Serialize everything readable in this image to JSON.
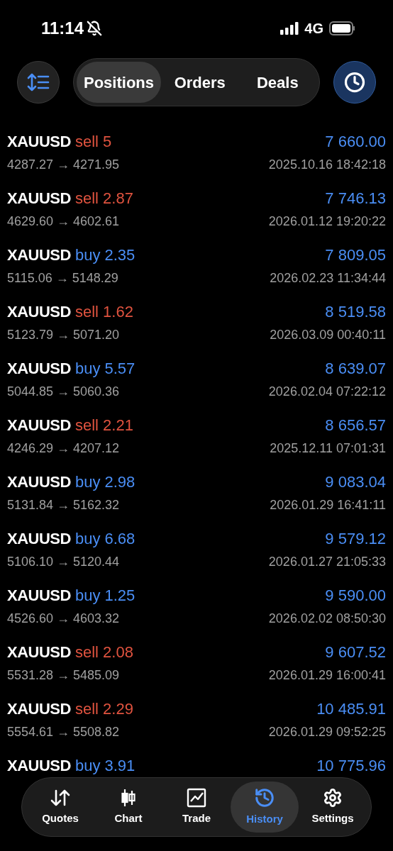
{
  "status_bar": {
    "time": "11:14",
    "network": "4G"
  },
  "segments": [
    {
      "label": "Positions",
      "selected": true
    },
    {
      "label": "Orders",
      "selected": false
    },
    {
      "label": "Deals",
      "selected": false
    }
  ],
  "deals": [
    {
      "symbol": "XAUUSD",
      "side": "sell",
      "volume": "5",
      "prices": "4287.27 → 4271.95",
      "profit": "7 660.00",
      "time": "2025.10.16 18:42:18"
    },
    {
      "symbol": "XAUUSD",
      "side": "sell",
      "volume": "2.87",
      "prices": "4629.60 → 4602.61",
      "profit": "7 746.13",
      "time": "2026.01.12 19:20:22"
    },
    {
      "symbol": "XAUUSD",
      "side": "buy",
      "volume": "2.35",
      "prices": "5115.06 → 5148.29",
      "profit": "7 809.05",
      "time": "2026.02.23 11:34:44"
    },
    {
      "symbol": "XAUUSD",
      "side": "sell",
      "volume": "1.62",
      "prices": "5123.79 → 5071.20",
      "profit": "8 519.58",
      "time": "2026.03.09 00:40:11"
    },
    {
      "symbol": "XAUUSD",
      "side": "buy",
      "volume": "5.57",
      "prices": "5044.85 → 5060.36",
      "profit": "8 639.07",
      "time": "2026.02.04 07:22:12"
    },
    {
      "symbol": "XAUUSD",
      "side": "sell",
      "volume": "2.21",
      "prices": "4246.29 → 4207.12",
      "profit": "8 656.57",
      "time": "2025.12.11 07:01:31"
    },
    {
      "symbol": "XAUUSD",
      "side": "buy",
      "volume": "2.98",
      "prices": "5131.84 → 5162.32",
      "profit": "9 083.04",
      "time": "2026.01.29 16:41:11"
    },
    {
      "symbol": "XAUUSD",
      "side": "buy",
      "volume": "6.68",
      "prices": "5106.10 → 5120.44",
      "profit": "9 579.12",
      "time": "2026.01.27 21:05:33"
    },
    {
      "symbol": "XAUUSD",
      "side": "buy",
      "volume": "1.25",
      "prices": "4526.60 → 4603.32",
      "profit": "9 590.00",
      "time": "2026.02.02 08:50:30"
    },
    {
      "symbol": "XAUUSD",
      "side": "sell",
      "volume": "2.08",
      "prices": "5531.28 → 5485.09",
      "profit": "9 607.52",
      "time": "2026.01.29 16:00:41"
    },
    {
      "symbol": "XAUUSD",
      "side": "sell",
      "volume": "2.29",
      "prices": "5554.61 → 5508.82",
      "profit": "10 485.91",
      "time": "2026.01.29 09:52:25"
    },
    {
      "symbol": "XAUUSD",
      "side": "buy",
      "volume": "3.91",
      "profit": "10 775.96"
    }
  ],
  "tab_bar": [
    {
      "kind": "quotes",
      "label": "Quotes",
      "selected": false
    },
    {
      "kind": "chart",
      "label": "Chart",
      "selected": false
    },
    {
      "kind": "trade",
      "label": "Trade",
      "selected": false
    },
    {
      "kind": "history",
      "label": "History",
      "selected": true
    },
    {
      "kind": "settings",
      "label": "Settings",
      "selected": false
    }
  ]
}
